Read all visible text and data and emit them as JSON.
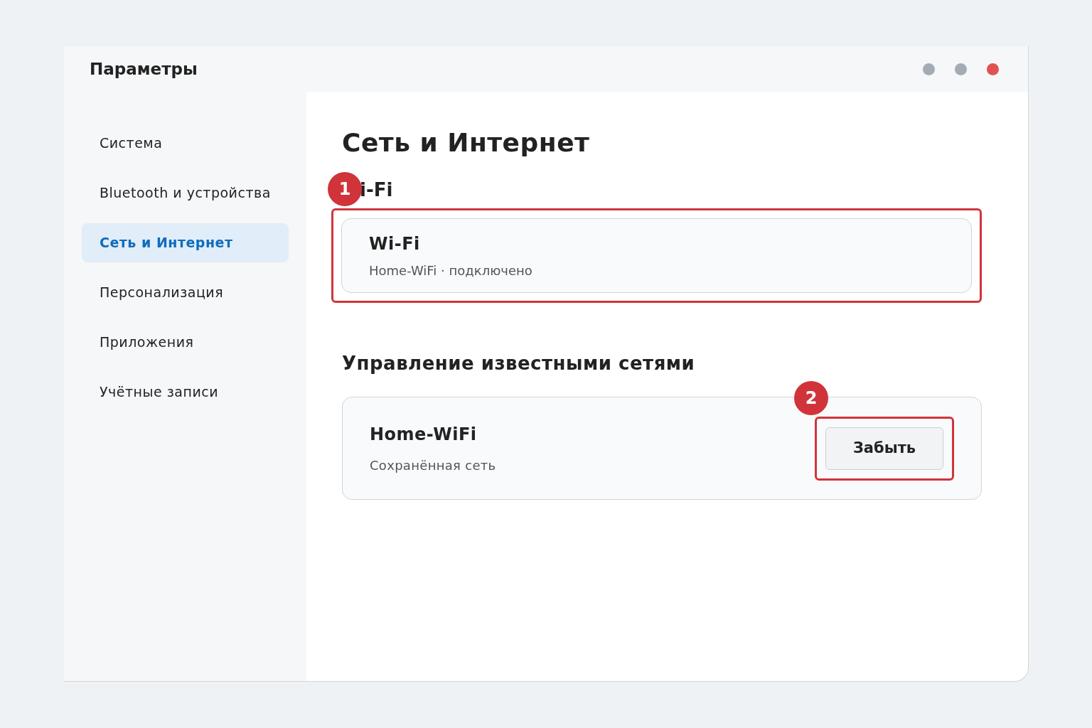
{
  "window": {
    "title": "Параметры",
    "controls": [
      {
        "color": "#a3abb5"
      },
      {
        "color": "#a3abb5"
      },
      {
        "color": "#e05252"
      }
    ]
  },
  "sidebar": {
    "items": [
      {
        "label": "Система",
        "selected": false
      },
      {
        "label": "Bluetooth и устройства",
        "selected": false
      },
      {
        "label": "Сеть и Интернет",
        "selected": true
      },
      {
        "label": "Персонализация",
        "selected": false
      },
      {
        "label": "Приложения",
        "selected": false
      },
      {
        "label": "Учётные записи",
        "selected": false
      }
    ]
  },
  "page": {
    "title": "Сеть и Интернет",
    "wifi_heading": "i-Fi",
    "wifi_card": {
      "title": "Wi-Fi",
      "subtitle": "Home-WiFi · подключено"
    },
    "known_heading": "Управление известными сетями",
    "network_card": {
      "title": "Home-WiFi",
      "subtitle": "Сохранённая сеть",
      "button": "Забыть"
    }
  },
  "annotations": [
    {
      "label": "1"
    },
    {
      "label": "2"
    }
  ]
}
